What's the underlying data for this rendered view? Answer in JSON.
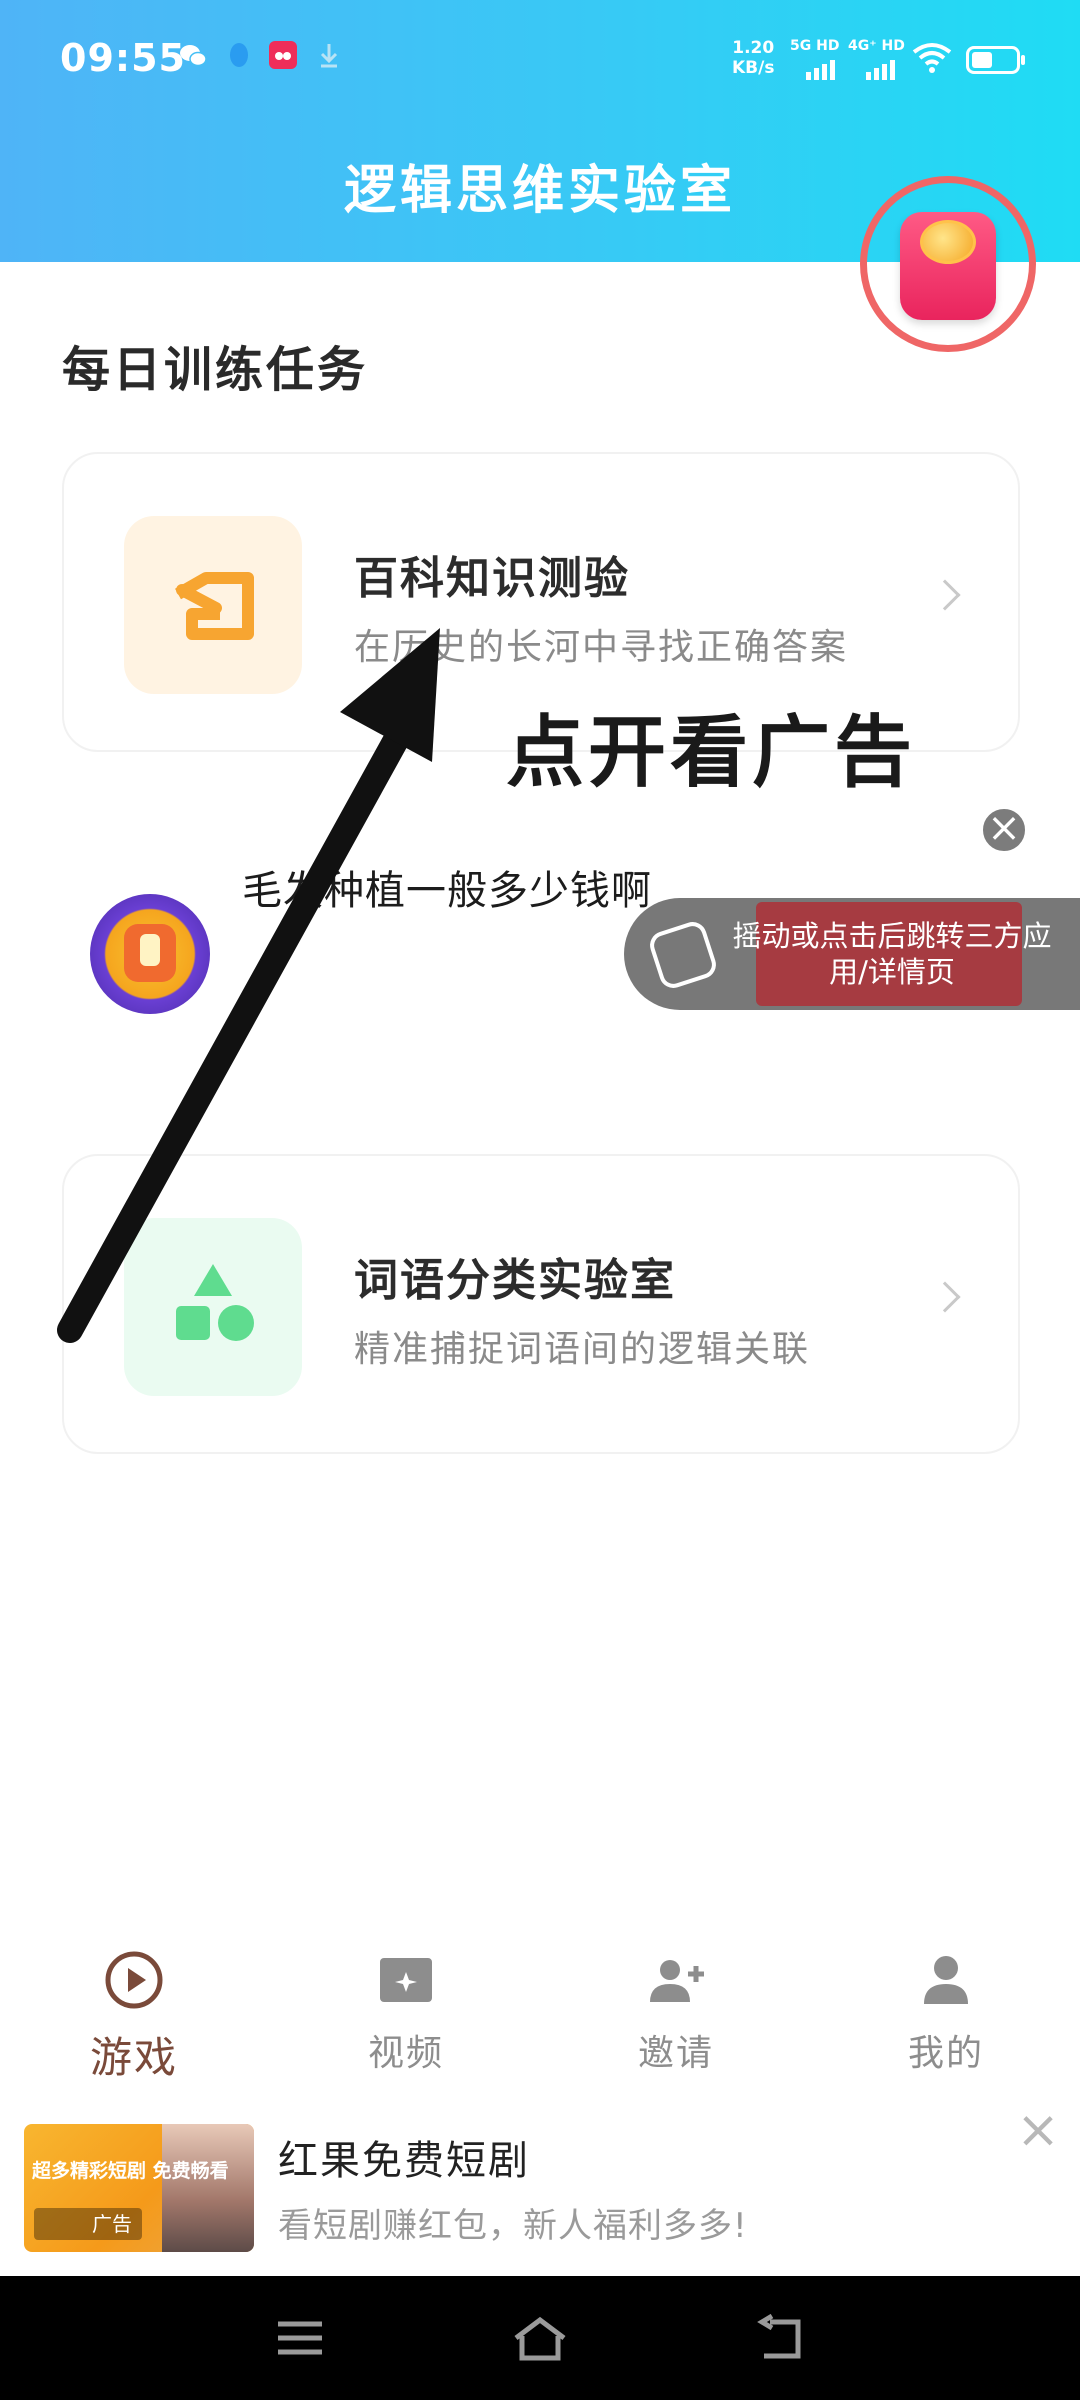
{
  "status_bar": {
    "time": "09:55",
    "net_speed_value": "1.20",
    "net_speed_unit": "KB/s",
    "sim1_label": "5G HD",
    "sim2_label": "4G⁺ HD",
    "icons": [
      "wechat-icon",
      "qq-icon",
      "app-icon",
      "download-icon",
      "wifi-icon",
      "battery-icon"
    ]
  },
  "header": {
    "title": "逻辑思维实验室"
  },
  "section": {
    "title": "每日训练任务"
  },
  "tasks": [
    {
      "title": "百科知识测验",
      "desc": "在历史的长河中寻找正确答案",
      "icon": "quiz-icon",
      "icon_bg": "#fff3e2",
      "icon_color": "#f7a531"
    },
    {
      "title": "词语分类实验室",
      "desc": "精准捕捉词语间的逻辑关联",
      "icon": "shapes-icon",
      "icon_bg": "#eafbf1",
      "icon_color": "#5fdc8f"
    }
  ],
  "annotation": {
    "open_ad": "点开看广告"
  },
  "ad_overlay": {
    "query": "毛发种植一般多少钱啊",
    "shake_text": "摇动或点击后跳转三方应用/详情页"
  },
  "tabbar": {
    "items": [
      {
        "label": "游戏",
        "icon": "play-icon",
        "active": true
      },
      {
        "label": "视频",
        "icon": "video-icon",
        "active": false
      },
      {
        "label": "邀请",
        "icon": "invite-icon",
        "active": false
      },
      {
        "label": "我的",
        "icon": "profile-icon",
        "active": false
      }
    ]
  },
  "banner_ad": {
    "image_text": "超多精彩短剧 免费畅看",
    "ad_tag": "广告",
    "title": "红果免费短剧",
    "subtitle": "看短剧赚红包，新人福利多多!"
  },
  "colors": {
    "header_start": "#4fb4f7",
    "header_end": "#1fdcf4",
    "active_tab": "#7a4a3a",
    "inactive_tab": "#8d8d8d"
  }
}
